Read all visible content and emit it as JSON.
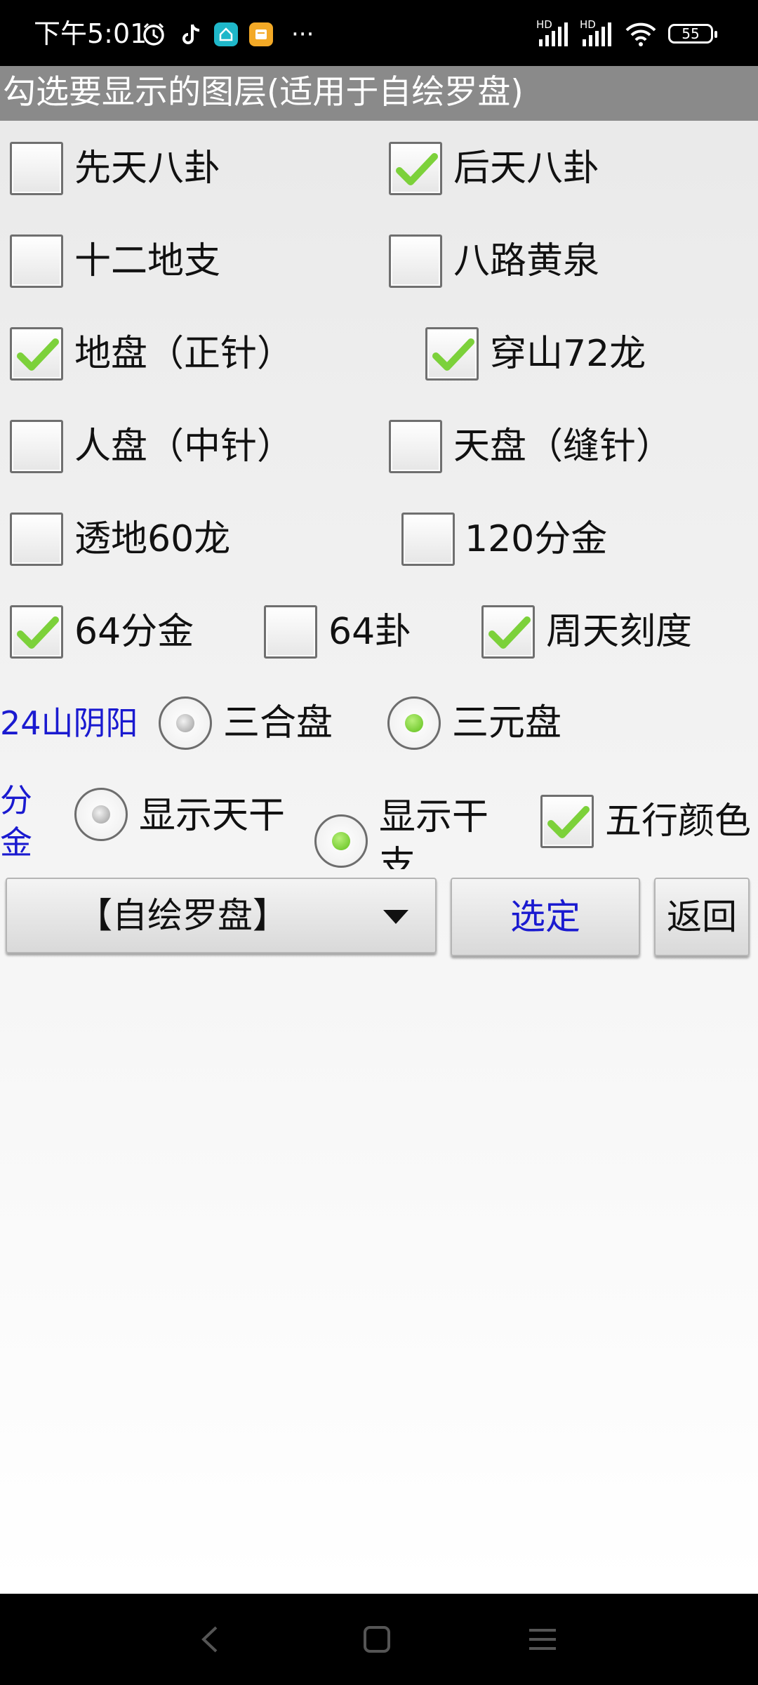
{
  "status_bar": {
    "time": "下午5:01",
    "icons": [
      "alarm-icon",
      "tiktok-icon",
      "home-app-icon",
      "notes-app-icon",
      "more-icon",
      "signal-hd-icon",
      "signal-hd-icon",
      "wifi-icon",
      "battery-icon"
    ],
    "signal1_label": "HD",
    "signal2_label": "HD",
    "more": "···",
    "battery": "55"
  },
  "header": {
    "title": "勾选要显示的图层(适用于自绘罗盘)"
  },
  "layers": [
    {
      "label": "先天八卦",
      "checked": false
    },
    {
      "label": "后天八卦",
      "checked": true
    },
    {
      "label": "十二地支",
      "checked": false
    },
    {
      "label": "八路黄泉",
      "checked": false
    },
    {
      "label": "地盘（正针）",
      "checked": true
    },
    {
      "label": "穿山72龙",
      "checked": true
    },
    {
      "label": "人盘（中针）",
      "checked": false
    },
    {
      "label": "天盘（缝针）",
      "checked": false
    },
    {
      "label": "透地60龙",
      "checked": false
    },
    {
      "label": "120分金",
      "checked": false
    },
    {
      "label": "64分金",
      "checked": true
    },
    {
      "label": "64卦",
      "checked": false
    },
    {
      "label": "周天刻度",
      "checked": true
    }
  ],
  "yinyang": {
    "label": "24山阴阳",
    "options": [
      {
        "label": "三合盘",
        "selected": false
      },
      {
        "label": "三元盘",
        "selected": true
      }
    ]
  },
  "fenjin": {
    "label_line1": "分",
    "label_line2": "金",
    "options": [
      {
        "label": "显示天干",
        "selected": false
      },
      {
        "label_line1": "显示干",
        "label_line2": "支",
        "selected": true
      }
    ],
    "wuxing_color": {
      "label": "五行颜色",
      "checked": true
    }
  },
  "actions": {
    "dropdown_value": "【自绘罗盘】",
    "select_button": "选定",
    "back_button": "返回"
  },
  "colors": {
    "accent_check": "#7cd13a",
    "blue_label": "#1a1ad0",
    "title_bar": "#8a8a8a"
  }
}
